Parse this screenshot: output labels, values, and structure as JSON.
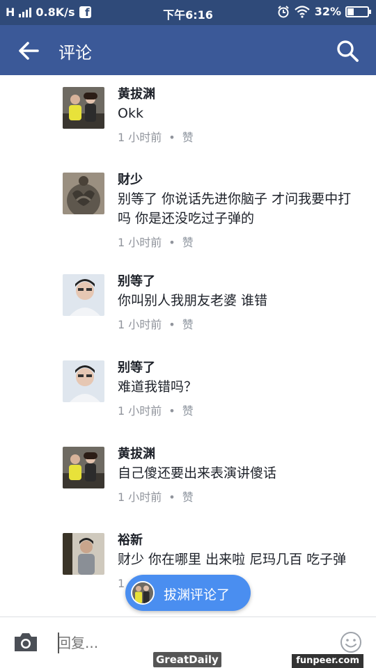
{
  "status_bar": {
    "carrier": "H",
    "speed": "0.8K/s",
    "app_badge": "f",
    "time": "下午6:16",
    "battery": "32%",
    "battery_level": 0.32
  },
  "header": {
    "title": "评论",
    "back_icon": "arrow-left-icon",
    "search_icon": "search-icon"
  },
  "comments": [
    {
      "name": "黄拔渊",
      "text": "Okk",
      "time": "1 小时前",
      "like": "赞"
    },
    {
      "name": "财少",
      "text": "别等了 你说话先进你脑子 才问我要中打吗 你是还没吃过子弹的",
      "time": "1 小时前",
      "like": "赞"
    },
    {
      "name": "别等了",
      "text": "你叫别人我朋友老婆 谁错",
      "time": "1 小时前",
      "like": "赞"
    },
    {
      "name": "别等了",
      "text": "难道我错吗？",
      "time": "1 小时前",
      "like": "赞"
    },
    {
      "name": "黄拔渊",
      "text": "自己傻还要出来表演讲傻话",
      "time": "1 小时前",
      "like": "赞"
    },
    {
      "name": "裕新",
      "text": "财少 你在哪里 出来啦 尼玛几百 吃子弹",
      "time": "1",
      "like": ""
    }
  ],
  "meta_separator": "•",
  "new_comment_pill": {
    "label": "拔渊评论了"
  },
  "composer": {
    "placeholder": "回复...",
    "camera_icon": "camera-icon",
    "emoji_icon": "smiley-icon"
  },
  "watermarks": {
    "left": "GreatDaily",
    "right": "funpeer.com"
  },
  "colors": {
    "header": "#3b5998",
    "status_bar": "#2f4a79",
    "pill": "#4a8ef0"
  }
}
